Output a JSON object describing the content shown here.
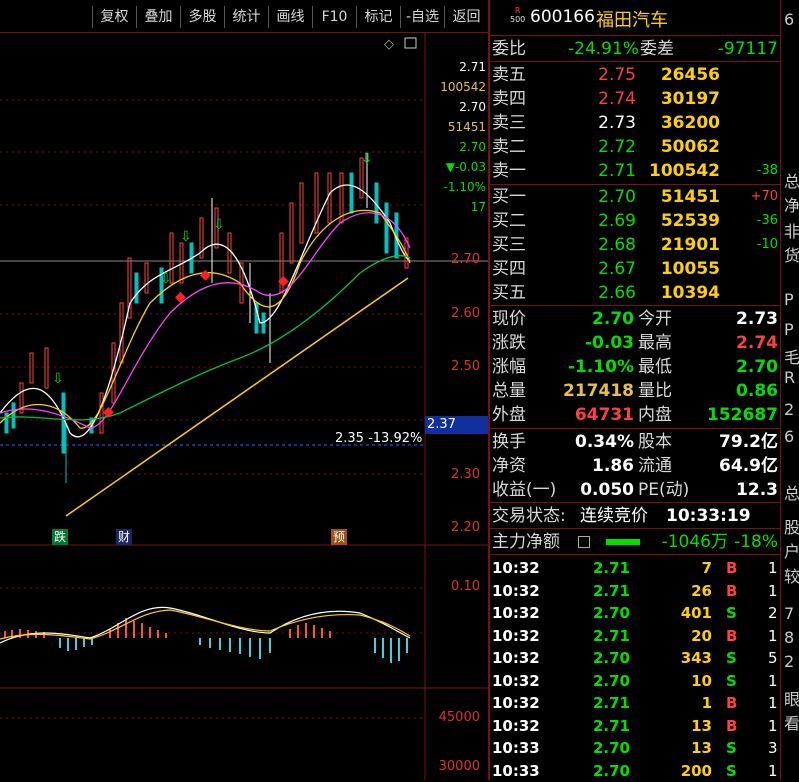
{
  "toolbar": {
    "buttons": [
      "复权",
      "叠加",
      "多股",
      "统计",
      "画线",
      "F10",
      "标记",
      "-自选",
      "返回"
    ]
  },
  "chart": {
    "price_axis": [
      "2.70",
      "2.60",
      "2.50",
      "2.30",
      "2.20"
    ],
    "macd_axis": [
      "0.10"
    ],
    "volume_axis": [
      "45000",
      "30000"
    ],
    "info_stack": [
      {
        "text": "2.71",
        "color": "#ffffff"
      },
      {
        "text": "100542",
        "color": "#e8c040"
      },
      {
        "text": "2.70",
        "color": "#ffffff"
      },
      {
        "text": "51451",
        "color": "#e8c040"
      },
      {
        "text": "2.70",
        "color": "#00e000"
      },
      {
        "text": "▼-0.03",
        "color": "#00e000"
      },
      {
        "text": "-1.10%",
        "color": "#00e000"
      },
      {
        "text": "17",
        "color": "#00e000"
      }
    ],
    "current_price_tag": "2.37",
    "low_annotation": "2.35 -13.92%",
    "markers": [
      "跌",
      "财",
      "预"
    ]
  },
  "stock": {
    "badge_top": "R",
    "badge_bottom": "500",
    "code": "600166",
    "name": "福田汽车"
  },
  "ratio": {
    "label1": "委比",
    "value1": "-24.91%",
    "label2": "委差",
    "value2": "-97117"
  },
  "asks": [
    {
      "label": "卖五",
      "price": "2.75",
      "vol": "26456",
      "chg": "",
      "price_color": "red"
    },
    {
      "label": "卖四",
      "price": "2.74",
      "vol": "30197",
      "chg": "",
      "price_color": "red"
    },
    {
      "label": "卖三",
      "price": "2.73",
      "vol": "36200",
      "chg": "",
      "price_color": "white"
    },
    {
      "label": "卖二",
      "price": "2.72",
      "vol": "50062",
      "chg": "",
      "price_color": "green"
    },
    {
      "label": "卖一",
      "price": "2.71",
      "vol": "100542",
      "chg": "-38",
      "price_color": "green"
    }
  ],
  "bids": [
    {
      "label": "买一",
      "price": "2.70",
      "vol": "51451",
      "chg": "+70",
      "price_color": "green"
    },
    {
      "label": "买二",
      "price": "2.69",
      "vol": "52539",
      "chg": "-36",
      "price_color": "green"
    },
    {
      "label": "买三",
      "price": "2.68",
      "vol": "21901",
      "chg": "-10",
      "price_color": "green"
    },
    {
      "label": "买四",
      "price": "2.67",
      "vol": "10055",
      "chg": "",
      "price_color": "green"
    },
    {
      "label": "买五",
      "price": "2.66",
      "vol": "10394",
      "chg": "",
      "price_color": "green"
    }
  ],
  "quote": [
    {
      "l1": "现价",
      "v1": "2.70",
      "c1": "green",
      "l2": "今开",
      "v2": "2.73",
      "c2": "white"
    },
    {
      "l1": "涨跌",
      "v1": "-0.03",
      "c1": "green",
      "l2": "最高",
      "v2": "2.74",
      "c2": "red"
    },
    {
      "l1": "涨幅",
      "v1": "-1.10%",
      "c1": "green",
      "l2": "最低",
      "v2": "2.70",
      "c2": "green"
    },
    {
      "l1": "总量",
      "v1": "217418",
      "c1": "yellow",
      "l2": "量比",
      "v2": "0.86",
      "c2": "green"
    },
    {
      "l1": "外盘",
      "v1": "64731",
      "c1": "red",
      "l2": "内盘",
      "v2": "152687",
      "c2": "green"
    }
  ],
  "fundamentals": [
    {
      "l1": "换手",
      "v1": "0.34%",
      "l2": "股本",
      "v2": "79.2亿"
    },
    {
      "l1": "净资",
      "v1": "1.86",
      "l2": "流通",
      "v2": "64.9亿"
    },
    {
      "l1": "收益(一)",
      "v1": "0.050",
      "l2": "PE(动)",
      "v2": "12.3"
    }
  ],
  "trade_status": {
    "label": "交易状态:",
    "value": "连续竞价",
    "time": "10:33:19"
  },
  "main_flow": {
    "label": "主力净额",
    "amount": "-1046万",
    "pct": "-18%"
  },
  "ticks": [
    {
      "time": "10:32",
      "price": "2.71",
      "vol": "7",
      "side": "B",
      "n": "1"
    },
    {
      "time": "10:32",
      "price": "2.71",
      "vol": "26",
      "side": "B",
      "n": "1"
    },
    {
      "time": "10:32",
      "price": "2.70",
      "vol": "401",
      "side": "S",
      "n": "2"
    },
    {
      "time": "10:32",
      "price": "2.71",
      "vol": "20",
      "side": "B",
      "n": "1"
    },
    {
      "time": "10:32",
      "price": "2.70",
      "vol": "343",
      "side": "S",
      "n": "5"
    },
    {
      "time": "10:32",
      "price": "2.70",
      "vol": "10",
      "side": "S",
      "n": "1"
    },
    {
      "time": "10:32",
      "price": "2.71",
      "vol": "1",
      "side": "B",
      "n": "1"
    },
    {
      "time": "10:32",
      "price": "2.71",
      "vol": "13",
      "side": "B",
      "n": "1"
    },
    {
      "time": "10:33",
      "price": "2.70",
      "vol": "13",
      "side": "S",
      "n": "3"
    },
    {
      "time": "10:33",
      "price": "2.70",
      "vol": "200",
      "side": "S",
      "n": "1"
    }
  ],
  "edge_chars": [
    "6",
    "总",
    "净",
    "非",
    "货",
    "P",
    "P",
    "毛",
    "R",
    "2",
    "6",
    "总",
    "股",
    "户",
    "较",
    "7",
    "8",
    "2",
    "眼",
    "看"
  ]
}
